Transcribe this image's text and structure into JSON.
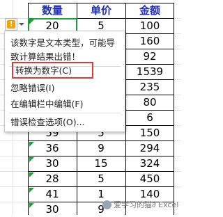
{
  "headers": [
    "数量",
    "单价",
    "金额"
  ],
  "rows": [
    [
      "20",
      "5",
      "100"
    ],
    [
      "",
      "",
      "160"
    ],
    [
      "",
      "",
      "92"
    ],
    [
      "",
      "",
      "1539"
    ],
    [
      "",
      "",
      "235"
    ],
    [
      "",
      "",
      "80"
    ],
    [
      "",
      "",
      "6"
    ],
    [
      "",
      "",
      "150"
    ],
    [
      "59",
      "5",
      "294"
    ],
    [
      "36",
      "9",
      "324"
    ],
    [
      "30",
      "15",
      "450"
    ],
    [
      "28",
      "5",
      "140"
    ],
    [
      "41",
      "1",
      "53"
    ],
    [
      "30",
      "",
      ""
    ]
  ],
  "menu": {
    "message": "该数字是文本类型，可能导致计算结果出错！",
    "items": [
      "转换为数字(C)",
      "忽略错误(I)",
      "在编辑栏中编辑(F)",
      "错误检查选项(O)..."
    ]
  },
  "watermark": {
    "partial_value": "9",
    "text": "爱学习的猫∂ Excel"
  },
  "colors": {
    "header": "#1f2fb8",
    "active": "#1c9c3a",
    "highlight": "#d93b3b",
    "warning": "#f2a500"
  },
  "icons": {
    "warning": "warning-icon",
    "dropdown": "dropdown-arrow-icon"
  }
}
